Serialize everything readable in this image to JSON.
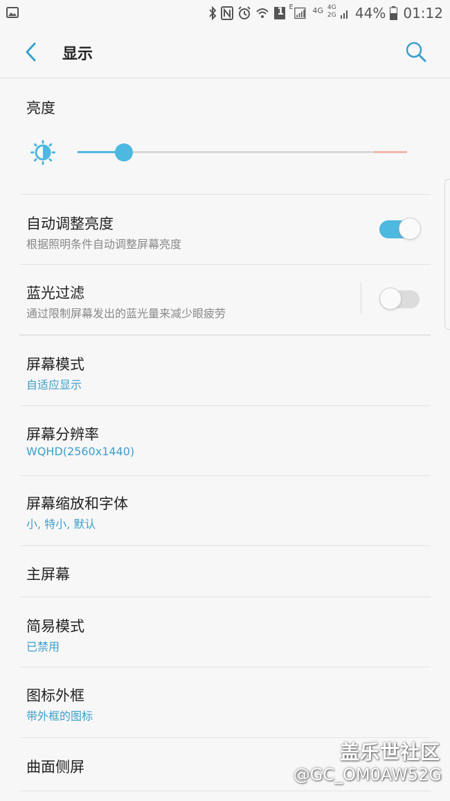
{
  "status_bar": {
    "network_e": "E",
    "network_4g_a": "4G",
    "network_4g_b": "4G",
    "network_2g": "2G",
    "battery_percent": "44%",
    "time": "01:12",
    "sim_badge": "1",
    "icons": [
      "gallery-icon",
      "bluetooth-icon",
      "nfc-icon",
      "alarm-icon",
      "wifi-icon",
      "sim-icon",
      "signal-icon",
      "battery-icon"
    ]
  },
  "appbar": {
    "title": "显示",
    "icons": [
      "back-arrow-icon",
      "search-icon"
    ]
  },
  "brightness": {
    "title": "亮度",
    "level": 0.14,
    "warn_from": 0.9,
    "accent": "#4db8e0",
    "warn_color": "#f2b5ab"
  },
  "auto_brightness": {
    "title": "自动调整亮度",
    "subtitle": "根据照明条件自动调整屏幕亮度",
    "enabled": true
  },
  "blue_light": {
    "title": "蓝光过滤",
    "subtitle": "通过限制屏幕发出的蓝光量来减少眼疲劳",
    "enabled": false
  },
  "items": [
    {
      "title": "屏幕模式",
      "subtitle": "自适应显示"
    },
    {
      "title": "屏幕分辨率",
      "subtitle": "WQHD(2560x1440)"
    },
    {
      "title": "屏幕缩放和字体",
      "subtitle": "小, 特小, 默认"
    },
    {
      "title": "主屏幕",
      "subtitle": ""
    },
    {
      "title": "简易模式",
      "subtitle": "已禁用"
    },
    {
      "title": "图标外框",
      "subtitle": "带外框的图标"
    },
    {
      "title": "曲面侧屏",
      "subtitle": ""
    }
  ],
  "watermark": {
    "line1": "盖乐世社区",
    "line2": "@GC_OM0AW52G"
  }
}
